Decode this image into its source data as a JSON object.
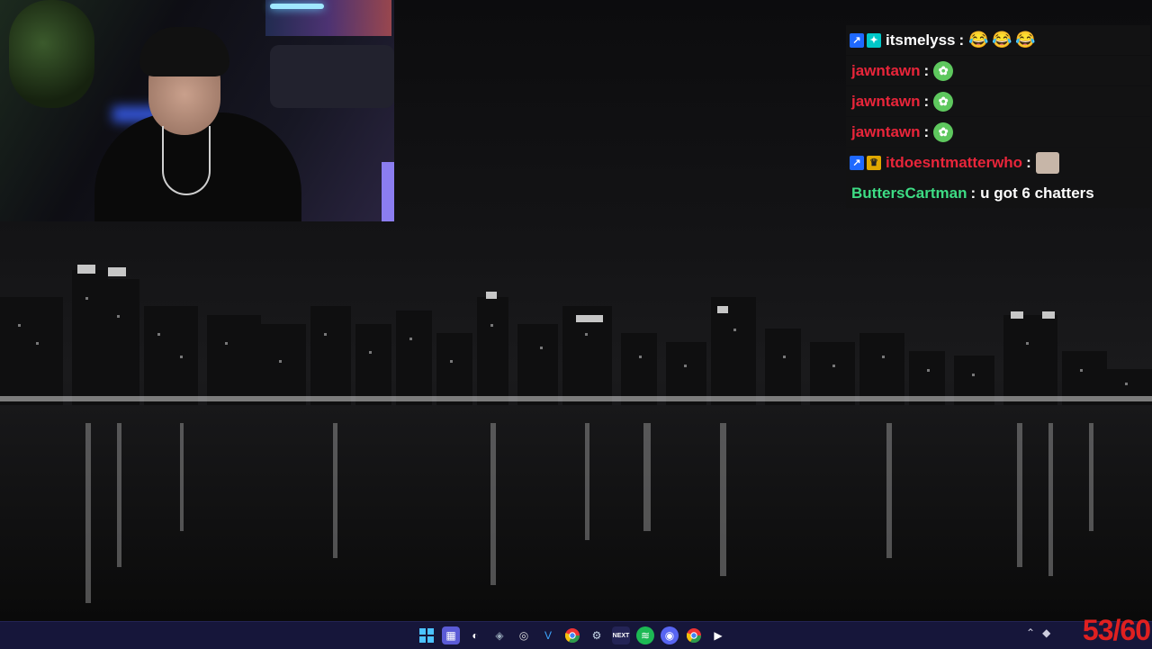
{
  "chat": {
    "messages": [
      {
        "badges": [
          "prime",
          "icon2"
        ],
        "user": "itsmelyss",
        "user_color": "#ffffff",
        "sep": ":",
        "emotes": [
          "😂",
          "😂",
          "😂"
        ],
        "text": ""
      },
      {
        "badges": [],
        "user": "jawntawn",
        "user_color": "#e8253a",
        "sep": ":",
        "emotes": [
          "green-emote"
        ],
        "text": ""
      },
      {
        "badges": [],
        "user": "jawntawn",
        "user_color": "#e8253a",
        "sep": ":",
        "emotes": [
          "green-emote"
        ],
        "text": ""
      },
      {
        "badges": [],
        "user": "jawntawn",
        "user_color": "#e8253a",
        "sep": ":",
        "emotes": [
          "green-emote"
        ],
        "text": ""
      },
      {
        "badges": [
          "prime",
          "crown"
        ],
        "user": "itdoesntmatterwho",
        "user_color": "#e8253a",
        "sep": ":",
        "emotes": [
          "face-emote"
        ],
        "text": ""
      },
      {
        "badges": [],
        "user": "ButtersCartman",
        "user_color": "#3ddc84",
        "sep": ":",
        "emotes": [],
        "text": "u got 6 chatters"
      }
    ]
  },
  "taskbar": {
    "icons": [
      "windows-start-icon",
      "apps-grid-icon",
      "app-icon",
      "vscode-like-icon",
      "obs-icon",
      "vscode-icon",
      "chrome-icon",
      "steam-icon",
      "next-icon",
      "spotify-icon",
      "discord-icon",
      "chrome-icon",
      "media-player-icon"
    ],
    "next_label": "NEXT"
  },
  "overlay": {
    "counter": "53/60"
  },
  "colors": {
    "taskbar_bg": "#16163a",
    "counter": "#e02020",
    "chat_bg": "#121214"
  }
}
